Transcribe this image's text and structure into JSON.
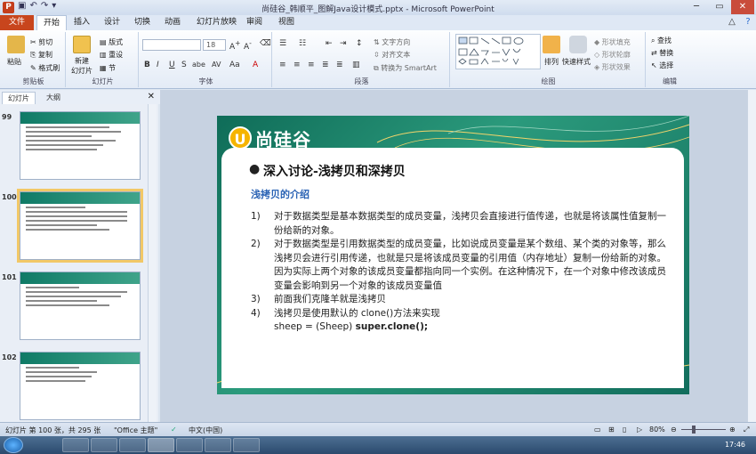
{
  "window": {
    "title": "尚硅谷_韩顺平_图解Java设计模式.pptx - Microsoft PowerPoint",
    "app_icon": "P"
  },
  "ribbon_tabs": [
    "文件",
    "开始",
    "插入",
    "设计",
    "切换",
    "动画",
    "幻灯片放映",
    "审阅",
    "视图"
  ],
  "active_tab": "开始",
  "clipboard": {
    "paste": "粘贴",
    "cut": "剪切",
    "copy": "复制",
    "format_painter": "格式刷",
    "label": "剪贴板"
  },
  "slides_group": {
    "new_slide": "新建",
    "new_slide2": "幻灯片",
    "layout": "版式",
    "reset": "重设",
    "section": "节",
    "label": "幻灯片"
  },
  "font_group": {
    "font_name": "",
    "font_size": "18",
    "label": "字体",
    "bold": "B",
    "italic": "I",
    "underline": "U",
    "strike": "S",
    "shadow": "abe",
    "spacing": "AV",
    "case": "Aa",
    "color": "A"
  },
  "paragraph_group": {
    "text_direction": "文字方向",
    "align_text": "对齐文本",
    "smartart": "转换为 SmartArt",
    "label": "段落"
  },
  "drawing_group": {
    "arrange": "排列",
    "quick_styles": "快速样式",
    "shape_fill": "形状填充",
    "shape_outline": "形状轮廓",
    "shape_effects": "形状效果",
    "label": "绘图"
  },
  "editing_group": {
    "find": "查找",
    "replace": "替换",
    "select": "选择",
    "label": "编辑"
  },
  "panel_tabs": [
    "幻灯片",
    "大纲"
  ],
  "thumbnails": [
    {
      "num": "99"
    },
    {
      "num": "100"
    },
    {
      "num": "101"
    },
    {
      "num": "102"
    }
  ],
  "slide": {
    "logo_letter": "U",
    "logo_text": "尚硅谷",
    "bullet": "●",
    "title": "深入讨论-浅拷贝和深拷贝",
    "subtitle": "浅拷贝的介绍",
    "items": [
      {
        "num": "1)",
        "text": "对于数据类型是基本数据类型的成员变量，浅拷贝会直接进行值传递，也就是将该属性值复制一份给新的对象。"
      },
      {
        "num": "2)",
        "text": "对于数据类型是引用数据类型的成员变量，比如说成员变量是某个数组、某个类的对象等，那么浅拷贝会进行引用传递，也就是只是将该成员变量的引用值（内存地址）复制一份给新的对象。因为实际上两个对象的该成员变量都指向同一个实例。在这种情况下，在一个对象中修改该成员变量会影响到另一个对象的该成员变量值"
      },
      {
        "num": "3)",
        "text": "前面我们克隆羊就是浅拷贝"
      },
      {
        "num": "4)",
        "text": "浅拷贝是使用默认的 clone()方法来实现"
      }
    ],
    "code_prefix": "sheep = (Sheep) ",
    "code_bold": "super.clone();"
  },
  "status": {
    "slide_info": "幻灯片 第 100 张，共 295 张",
    "theme": "\"Office 主题\"",
    "language": "中文(中国)",
    "zoom": "80%"
  },
  "taskbar": {
    "time": "17:46"
  }
}
